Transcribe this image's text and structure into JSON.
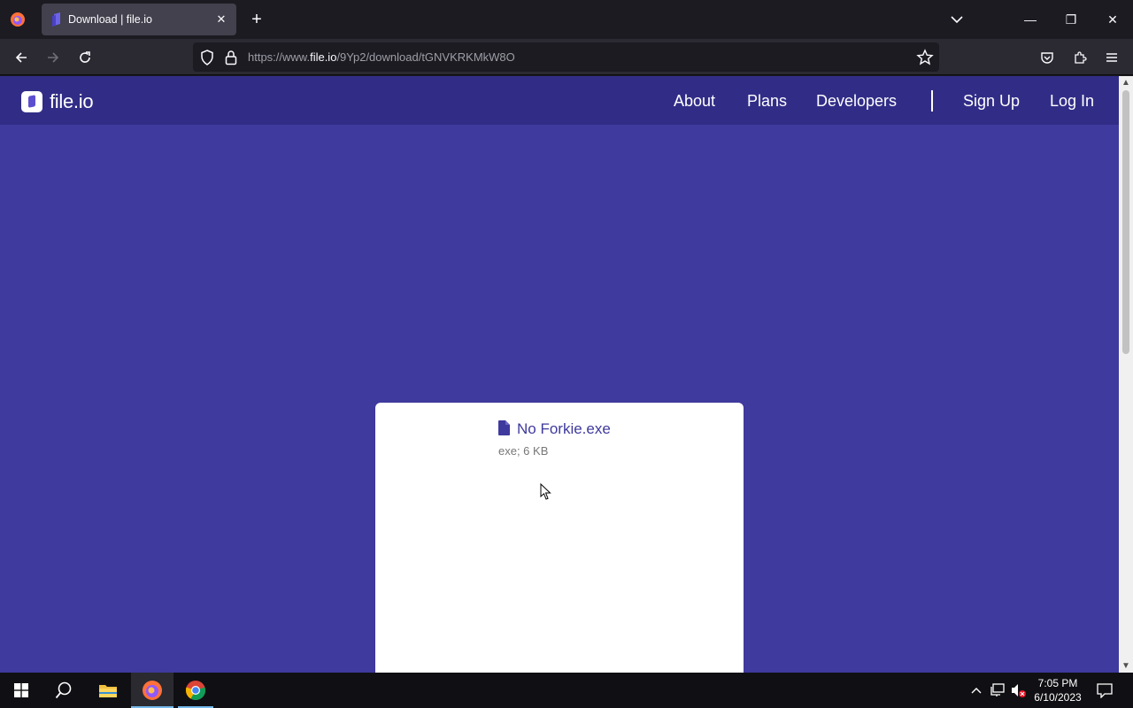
{
  "browser": {
    "tab": {
      "title": "Download | file.io",
      "close_glyph": "✕"
    },
    "new_tab_glyph": "+",
    "url": {
      "prefix": "https://www.",
      "host": "file.io",
      "path": "/9Yp2/download/tGNVKRKMkW8O"
    },
    "window_controls": {
      "minimize": "—",
      "restore": "❐",
      "close": "✕"
    }
  },
  "site": {
    "logo_text": "file.io",
    "nav": {
      "about": "About",
      "plans": "Plans",
      "developers": "Developers",
      "sign_up": "Sign Up",
      "log_in": "Log In"
    },
    "file": {
      "name": "No Forkie.exe",
      "meta": "exe; 6 KB"
    }
  },
  "taskbar": {
    "time": "7:05 PM",
    "date": "6/10/2023"
  },
  "colors": {
    "page_bg": "#3f3a9d",
    "header_bg": "#312d87",
    "accent": "#3f3a9d"
  }
}
